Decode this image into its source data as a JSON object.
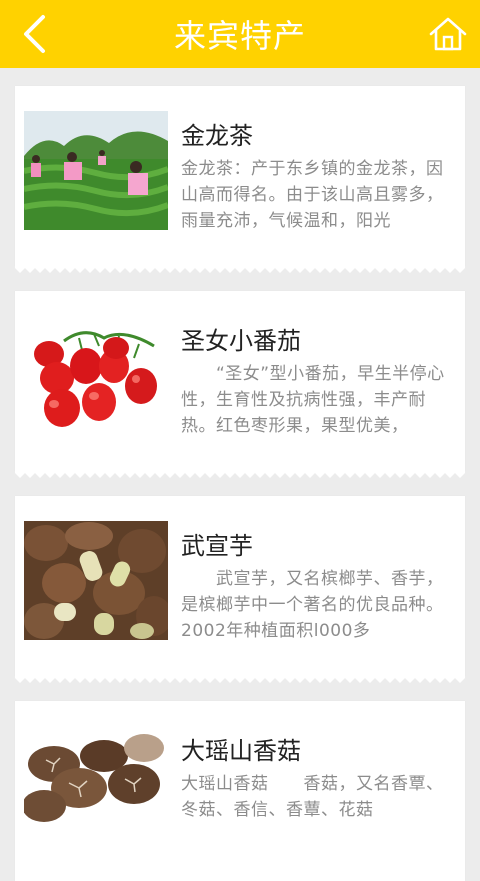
{
  "header": {
    "title": "来宾特产",
    "back_icon": "chevron-left-icon",
    "home_icon": "home-icon",
    "bg_color": "#ffd200"
  },
  "items": [
    {
      "name": "金龙茶",
      "desc": "金龙茶：产于东乡镇的金龙茶，因山高而得名。由于该山高且雾多，雨量充沛，气候温和，阳光",
      "image": "tea-plantation-photo"
    },
    {
      "name": "圣女小番茄",
      "desc": "　　“圣女”型小番茄，早生半停心性，生育性及抗病性强，丰产耐热。红色枣形果，果型优美，",
      "image": "cherry-tomatoes-photo"
    },
    {
      "name": "武宣芋",
      "desc": "　　武宣芋，又名槟榔芋、香芋，是槟榔芋中一个著名的优良品种。2002年种植面积l000多",
      "image": "taro-photo"
    },
    {
      "name": "大瑶山香菇",
      "desc": "大瑶山香菇　　香菇，又名香覃、冬菇、香信、香蕈、花菇",
      "image": "shiitake-photo"
    }
  ]
}
